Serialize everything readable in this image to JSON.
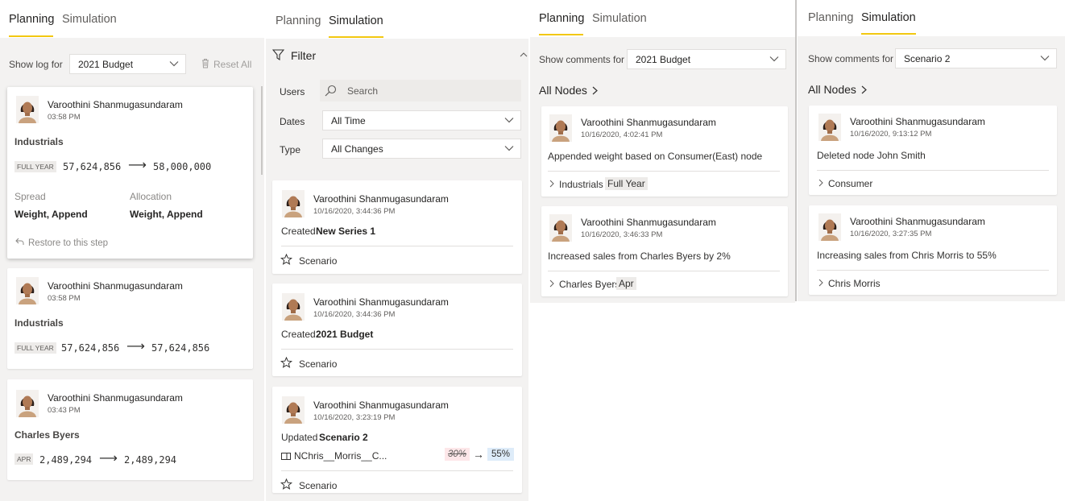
{
  "colors": {
    "accent": "#f2c811",
    "panel_bg": "#f3f2f1",
    "old_value_bg": "#fde7e9",
    "new_value_bg": "#deecf9"
  },
  "panel1": {
    "tabs": [
      "Planning",
      "Simulation"
    ],
    "show_log_label": "Show log for",
    "dropdown_value": "2021 Budget",
    "reset_label": "Reset All",
    "cards": [
      {
        "user": "Varoothini Shanmugasundaram",
        "time": "03:58 PM",
        "node": "Industrials",
        "badge": "FULL YEAR",
        "from": "57,624,856",
        "to": "58,000,000",
        "spread_label": "Spread",
        "spread_value": "Weight, Append",
        "allocation_label": "Allocation",
        "allocation_value": "Weight, Append",
        "restore_label": "Restore to this step"
      },
      {
        "user": "Varoothini Shanmugasundaram",
        "time": "03:58 PM",
        "node": "Industrials",
        "badge": "FULL YEAR",
        "from": "57,624,856",
        "to": "57,624,856"
      },
      {
        "user": "Varoothini Shanmugasundaram",
        "time": "03:43 PM",
        "node": "Charles Byers",
        "badge": "APR",
        "from": "2,489,294",
        "to": "2,489,294"
      }
    ]
  },
  "panel2": {
    "tabs": [
      "Planning",
      "Simulation"
    ],
    "filter_title": "Filter",
    "users_label": "Users",
    "search_placeholder": "Search",
    "dates_label": "Dates",
    "dates_value": "All Time",
    "type_label": "Type",
    "type_value": "All Changes",
    "cards": [
      {
        "user": "Varoothini Shanmugasundaram",
        "time": "10/16/2020, 3:44:36 PM",
        "action": "Created",
        "target": "New Series 1",
        "footer": "Scenario"
      },
      {
        "user": "Varoothini Shanmugasundaram",
        "time": "10/16/2020, 3:44:36 PM",
        "action": "Created",
        "target": "2021 Budget",
        "footer": "Scenario"
      },
      {
        "user": "Varoothini Shanmugasundaram",
        "time": "10/16/2020, 3:23:19 PM",
        "action": "Updated",
        "target": "Scenario 2",
        "series": "NChris__Morris__C...",
        "old_value": "30%",
        "new_value": "55%",
        "footer": "Scenario"
      }
    ]
  },
  "panel3": {
    "tabs": [
      "Planning",
      "Simulation"
    ],
    "show_comments_label": "Show comments for",
    "dropdown_value": "2021 Budget",
    "breadcrumb": "All Nodes",
    "cards": [
      {
        "user": "Varoothini Shanmugasundaram",
        "time": "10/16/2020, 4:02:41 PM",
        "comment": "Appended weight based on Consumer(East) node",
        "node": "Industrials",
        "tag": "Full Year"
      },
      {
        "user": "Varoothini Shanmugasundaram",
        "time": "10/16/2020, 3:46:33 PM",
        "comment": "Increased sales from Charles Byers by 2%",
        "node": "Charles Byers",
        "tag": "Apr"
      }
    ]
  },
  "panel4": {
    "tabs": [
      "Planning",
      "Simulation"
    ],
    "show_comments_label": "Show comments for",
    "dropdown_value": "Scenario 2",
    "breadcrumb": "All Nodes",
    "cards": [
      {
        "user": "Varoothini Shanmugasundaram",
        "time": "10/16/2020, 9:13:12 PM",
        "comment": "Deleted node John Smith",
        "node": "Consumer"
      },
      {
        "user": "Varoothini Shanmugasundaram",
        "time": "10/16/2020, 3:27:35 PM",
        "comment": "Increasing sales from Chris Morris to 55%",
        "node": "Chris Morris"
      }
    ]
  }
}
